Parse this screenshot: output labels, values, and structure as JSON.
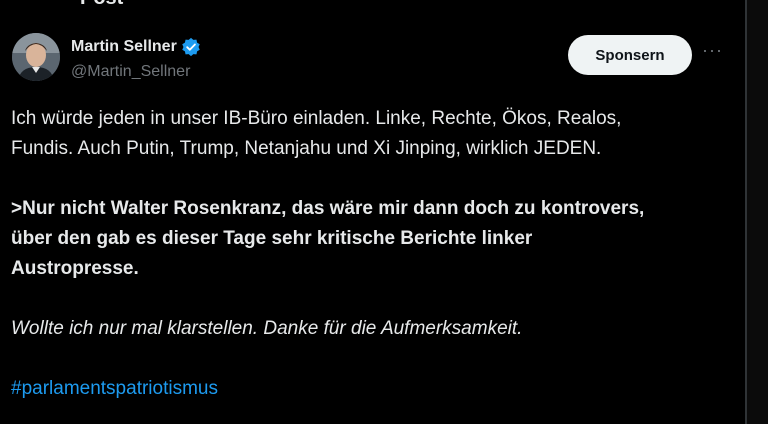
{
  "header": {
    "back_icon": "arrow-left-icon",
    "title": "Post"
  },
  "author": {
    "display_name": "Martin Sellner",
    "handle": "@Martin_Sellner",
    "verified_icon": "verified-badge-icon",
    "verified_color": "#1d9bf0"
  },
  "actions": {
    "sponsor_label": "Sponsern",
    "more_icon": "more-options-icon"
  },
  "tweet": {
    "paragraph1": [
      "Ich würde jeden in unser IB-Büro einladen. Linke, Rechte, Ökos, Realos,",
      "Fundis. Auch Putin, Trump, Netanjahu und Xi Jinping, wirklich JEDEN."
    ],
    "paragraph2": [
      ">Nur nicht Walter Rosenkranz, das wäre mir dann doch zu kontrovers,",
      "über den gab es dieser Tage sehr kritische Berichte linker",
      "Austropresse."
    ],
    "paragraph3": [
      "Wollte ich nur mal klarstellen. Danke für die Aufmerksamkeit."
    ],
    "hashtag": "#parlamentspatriotismus"
  },
  "colors": {
    "background": "#000000",
    "text": "#e7e9ea",
    "secondary_text": "#71767b",
    "link": "#1d9bf0",
    "button_bg": "#eff3f4"
  }
}
